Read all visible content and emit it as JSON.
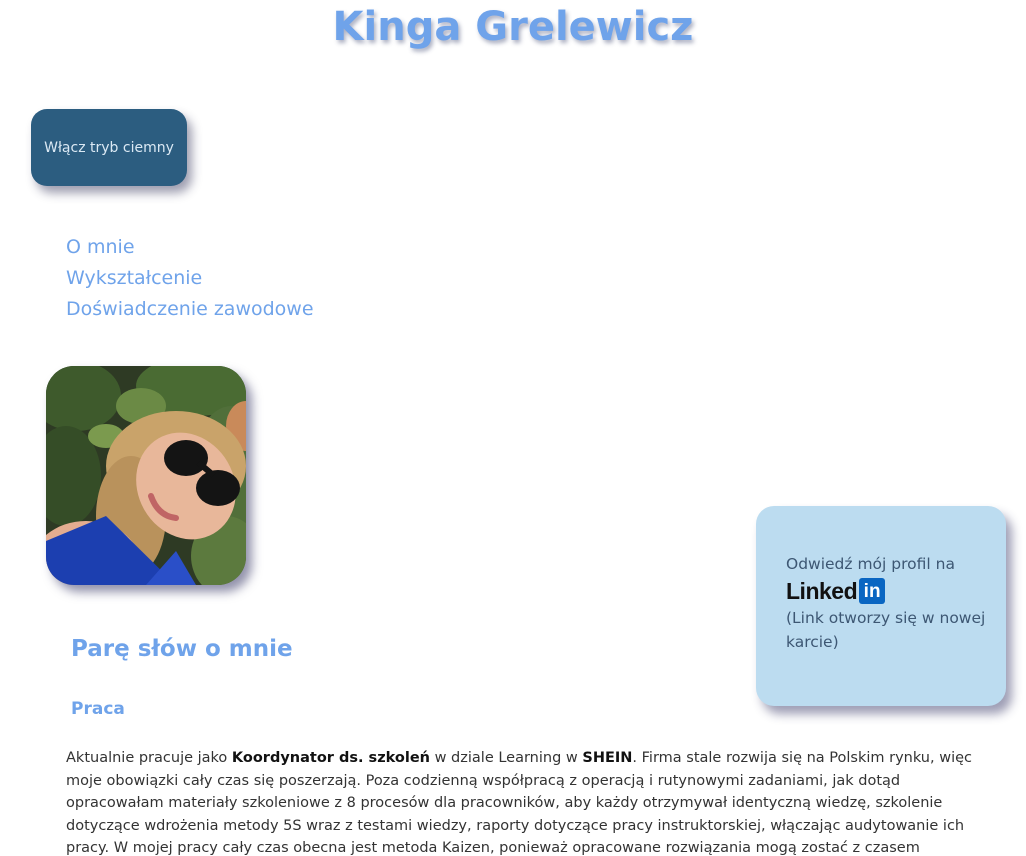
{
  "site_title": "Kinga Grelewicz",
  "dark_mode_button": "Włącz tryb ciemny",
  "nav": {
    "items": [
      {
        "label": "O mnie"
      },
      {
        "label": "Wykształcenie"
      },
      {
        "label": "Doświadczenie zawodowe"
      }
    ]
  },
  "linkedin": {
    "intro": "Odwiedź mój profil na",
    "logo_word": "Linked",
    "logo_in": "in",
    "note": "(Link otworzy się w nowej karcie)"
  },
  "about": {
    "heading": "Parę słów o mnie",
    "work_heading": "Praca",
    "paragraph": {
      "t1": "Aktualnie pracuje jako ",
      "b1": "Koordynator ds. szkoleń",
      "t2": " w dziale Learning w ",
      "b2": "SHEIN",
      "t3": ". Firma stale rozwija się na Polskim rynku, więc moje obowiązki cały czas się poszerzają. Poza codzienną współpracą z operacją i rutynowymi zadaniami, jak dotąd opracowałam materiały szkoleniowe z 8 procesów dla pracowników, aby każdy otrzymywał identyczną wiedzę, szkolenie dotyczące wdrożenia metody 5S wraz z testami wiedzy, raporty dotyczące pracy instruktorskiej, włączając audytowanie ich pracy. W mojej pracy cały czas obecna jest metoda Kaizen, ponieważ opracowane rozwiązania mogą zostać z czasem udoskonalone."
    }
  },
  "colors": {
    "accent": "#6fa3ea",
    "toggle_bg": "#2c5d80",
    "card_bg": "#bcdcf0",
    "linkedin_blue": "#0a66c2"
  },
  "icons": {
    "profile_photo": "profile-photo",
    "linkedin_logo": "linkedin-logo"
  }
}
